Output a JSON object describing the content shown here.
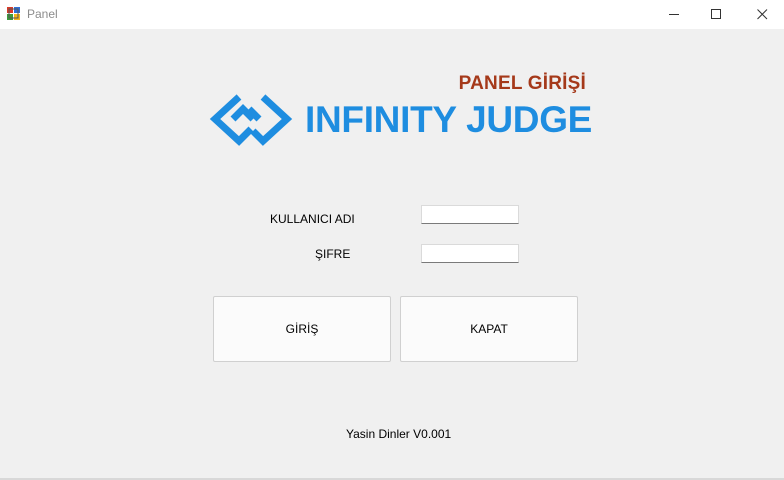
{
  "window": {
    "title": "Panel",
    "controls": {
      "minimize": "minimize-icon",
      "maximize": "maximize-icon",
      "close": "close-icon"
    }
  },
  "header": {
    "panel_title": "PANEL GİRİŞİ",
    "brand_name": "INFINITY JUDGE",
    "panel_title_color": "#a5391a",
    "brand_color": "#1e8de0"
  },
  "form": {
    "username_label": "KULLANICI ADI",
    "username_value": "",
    "password_label": "ŞIFRE",
    "password_value": ""
  },
  "buttons": {
    "login_label": "GİRİŞ",
    "close_label": "KAPAT"
  },
  "footer": {
    "text": "Yasin Dinler V0.001"
  }
}
